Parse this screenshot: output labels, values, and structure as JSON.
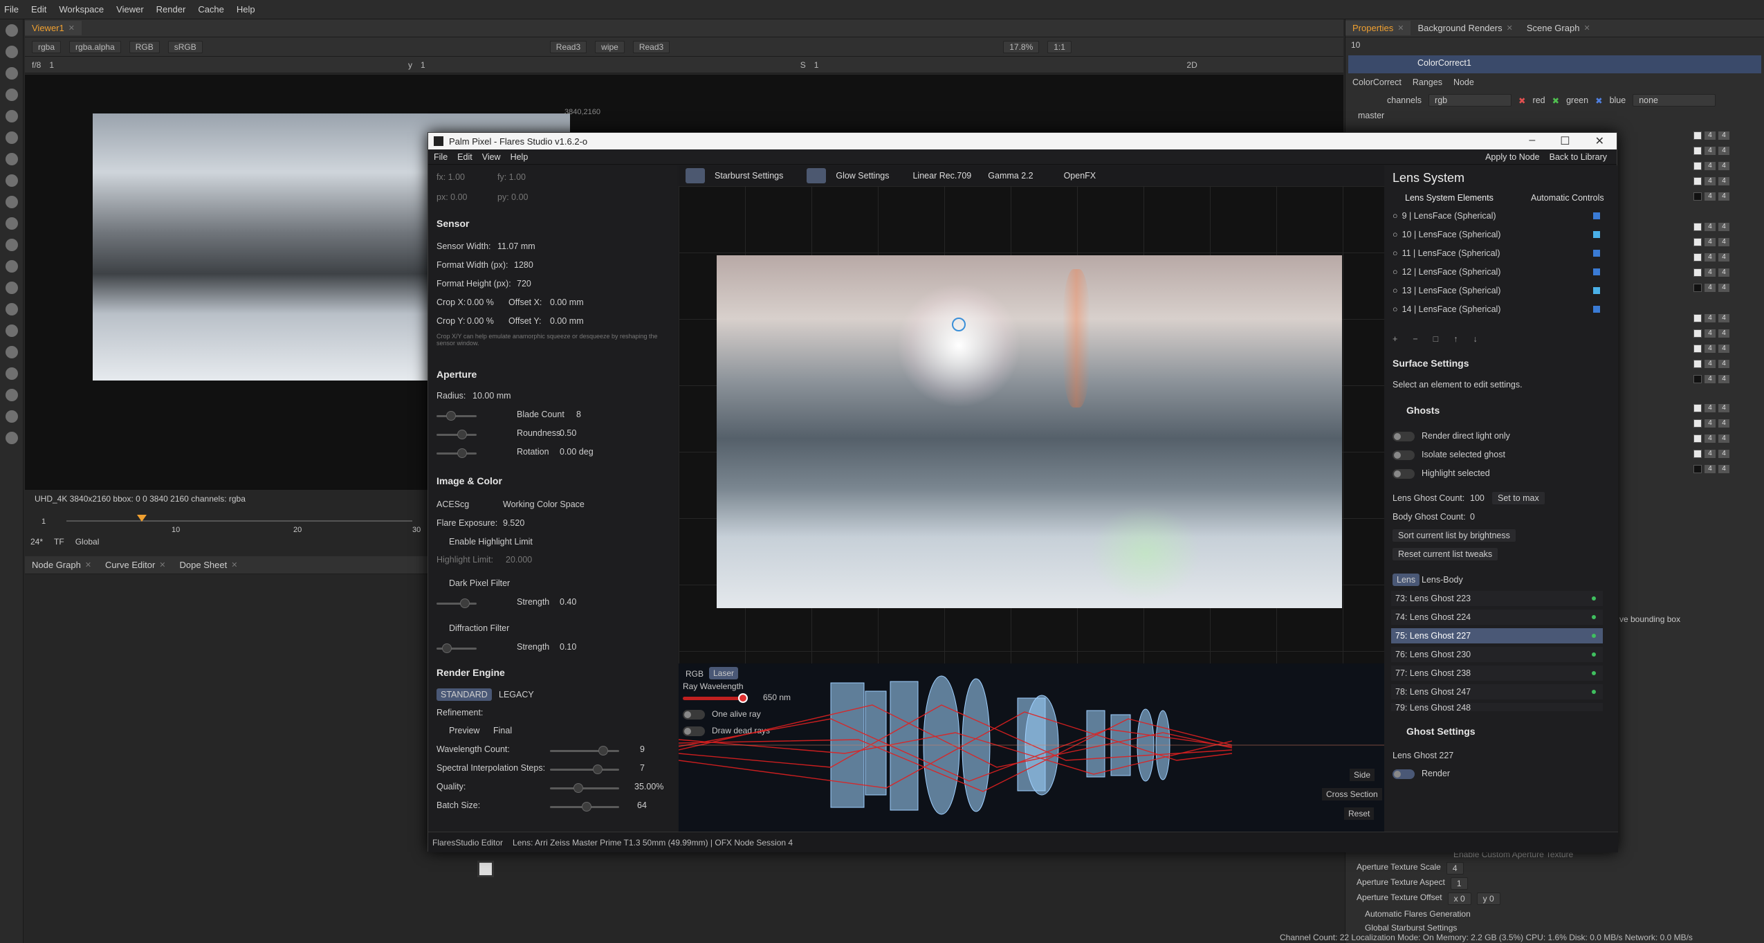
{
  "menu": {
    "file": "File",
    "edit": "Edit",
    "workspace": "Workspace",
    "viewer": "Viewer",
    "render": "Render",
    "cache": "Cache",
    "help": "Help"
  },
  "viewer": {
    "tab": "Viewer1",
    "channel": "rgba",
    "alpha": "rgba.alpha",
    "rgb": "RGB",
    "colorspace": "sRGB",
    "inputA": "Read3",
    "wipe": "wipe",
    "inputB": "Read3",
    "zoom": "17.8%",
    "ratio": "1:1",
    "fstop": "f/8",
    "frame": "1",
    "y": "y",
    "y_val": "1",
    "s": "S",
    "s_val": "1",
    "view2d": "2D",
    "format": "3840,2160",
    "info": "UHD_4K 3840x2160  bbox: 0 0 3840 2160 channels: rgba",
    "fps": "24*",
    "tf": "TF",
    "global": "Global",
    "ticks": [
      "1",
      "10",
      "20",
      "30"
    ]
  },
  "bottom_tabs": {
    "node": "Node Graph",
    "curve": "Curve Editor",
    "dope": "Dope Sheet"
  },
  "right_panel": {
    "tabs": [
      "Properties",
      "Background Renders",
      "Scene Graph"
    ],
    "count": "10",
    "node_name": "ColorCorrect1",
    "subtabs": [
      "ColorCorrect",
      "Ranges",
      "Node"
    ],
    "channels_label": "channels",
    "channels_val": "rgb",
    "red": "red",
    "green": "green",
    "blue": "blue",
    "none": "none",
    "master": "master",
    "bbox_text": "ve bounding box",
    "custom_aperture": "Enable Custom Aperture Texture",
    "ap_scale": "Aperture Texture Scale",
    "ap_scale_v": "4",
    "ap_aspect": "Aperture Texture Aspect",
    "ap_aspect_v": "1",
    "ap_offset": "Aperture Texture Offset",
    "ap_offset_x": "x 0",
    "ap_offset_y": "y 0",
    "auto_flares": "Automatic Flares Generation",
    "starburst": "Global Starburst Settings",
    "status": "Channel Count: 22 Localization Mode: On Memory: 2.2 GB (3.5%) CPU: 1.6% Disk: 0.0 MB/s Network: 0.0 MB/s"
  },
  "win": {
    "title": "Palm Pixel - Flares Studio v1.6.2-o",
    "menu": [
      "File",
      "Edit",
      "View",
      "Help"
    ],
    "apply": "Apply to Node",
    "back": "Back to Library",
    "fx": "fx: 1.00",
    "fy": "fy: 1.00",
    "px": "px: 0.00",
    "py": "py: 0.00",
    "sensor": {
      "title": "Sensor",
      "width": "Sensor Width:",
      "width_v": "11.07 mm",
      "fw": "Format Width (px):",
      "fw_v": "1280",
      "fh": "Format Height (px):",
      "fh_v": "720",
      "cropx": "Crop X:",
      "cropx_v": "0.00 %",
      "offx": "Offset X:",
      "offx_v": "0.00 mm",
      "cropy": "Crop Y:",
      "cropy_v": "0.00 %",
      "offy": "Offset Y:",
      "offy_v": "0.00 mm",
      "note": "Crop X/Y can help emulate anamorphic squeeze or desqueeze by reshaping the sensor window."
    },
    "aperture": {
      "title": "Aperture",
      "radius": "Radius:",
      "radius_v": "10.00 mm",
      "blade": "Blade Count",
      "blade_v": "8",
      "round": "Roundness",
      "round_v": "0.50",
      "rot": "Rotation",
      "rot_v": "0.00 deg"
    },
    "image": {
      "title": "Image & Color",
      "cs": "ACEScg",
      "wcs": "Working Color Space",
      "exp": "Flare Exposure:",
      "exp_v": "9.520",
      "hl": "Enable Highlight Limit",
      "hll": "Highlight Limit:",
      "hll_v": "20.000",
      "dpf": "Dark Pixel Filter",
      "strength": "Strength",
      "dpf_v": "0.40",
      "df": "Diffraction Filter",
      "df_v": "0.10"
    },
    "engine": {
      "title": "Render Engine",
      "std": "STANDARD",
      "legacy": "LEGACY",
      "refine": "Refinement:",
      "preview": "Preview",
      "final": "Final",
      "wl": "Wavelength Count:",
      "wl_v": "9",
      "sis": "Spectral Interpolation Steps:",
      "sis_v": "7",
      "q": "Quality:",
      "q_v": "35.00%",
      "bs": "Batch Size:",
      "bs_v": "64"
    },
    "center": {
      "starburst": "Starburst Settings",
      "glow": "Glow Settings",
      "linear": "Linear Rec.709",
      "gamma": "Gamma 2.2",
      "ofx": "OpenFX",
      "rgb": "RGB",
      "laser": "Laser",
      "ray": "Ray Wavelength",
      "ray_v": "650 nm",
      "alive": "One alive ray",
      "dead": "Draw dead rays",
      "side": "Side",
      "cross": "Cross Section",
      "reset": "Reset"
    },
    "lens": {
      "title": "Lens System",
      "elements": "Lens System Elements",
      "auto": "Automatic Controls",
      "items": [
        "9 | LensFace (Spherical)",
        "10 | LensFace (Spherical)",
        "11 | LensFace (Spherical)",
        "12 | LensFace (Spherical)",
        "13 | LensFace (Spherical)",
        "14 | LensFace (Spherical)"
      ],
      "ctrl": [
        "+",
        "−",
        "□",
        "↑",
        "↓"
      ],
      "surface": "Surface Settings",
      "surface_hint": "Select an element to edit settings.",
      "ghosts": "Ghosts",
      "rdl": "Render direct light only",
      "isg": "Isolate selected ghost",
      "hs": "Highlight selected",
      "lgc": "Lens Ghost Count:",
      "lgc_v": "100",
      "setmax": "Set to max",
      "bgc": "Body Ghost Count:",
      "bgc_v": "0",
      "sort": "Sort current list by brightness",
      "resetlist": "Reset current list tweaks",
      "t_lens": "Lens",
      "t_body": "Lens-Body",
      "ghost_list": [
        "73: Lens Ghost 223",
        "74: Lens Ghost 224",
        "75: Lens Ghost 227",
        "76: Lens Ghost 230",
        "77: Lens Ghost 238",
        "78: Lens Ghost 247",
        "79: Lens Ghost 248"
      ],
      "gs": "Ghost Settings",
      "lg": "Lens Ghost 227",
      "render": "Render"
    },
    "status": {
      "editor": "FlaresStudio Editor",
      "lens": "Lens: Arri Zeiss Master Prime T1.3 50mm (49.99mm) | OFX Node Session 4"
    }
  },
  "colors": {
    "accent": "#f0a030",
    "select": "#4a5876",
    "laser": "#e02020"
  }
}
